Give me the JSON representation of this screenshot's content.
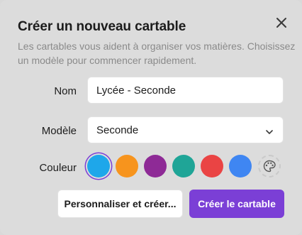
{
  "dialog": {
    "title": "Créer un nouveau cartable",
    "description": "Les cartables vous aident à organiser vos matières. Choisissez un modèle pour commencer rapidement."
  },
  "form": {
    "name_label": "Nom",
    "name_value": "Lycée - Seconde",
    "model_label": "Modèle",
    "model_value": "Seconde",
    "color_label": "Couleur",
    "colors": [
      {
        "name": "sky-blue",
        "hex": "#1ea7ea",
        "selected": true
      },
      {
        "name": "orange",
        "hex": "#f7941d",
        "selected": false
      },
      {
        "name": "purple",
        "hex": "#8e2a96",
        "selected": false
      },
      {
        "name": "teal",
        "hex": "#1fa597",
        "selected": false
      },
      {
        "name": "red",
        "hex": "#ea4444",
        "selected": false
      },
      {
        "name": "blue",
        "hex": "#3f86f2",
        "selected": false
      }
    ]
  },
  "actions": {
    "customize_label": "Personnaliser et créer...",
    "create_label": "Créer le cartable"
  },
  "icons": {
    "close": "close-icon",
    "chevron": "chevron-down-icon",
    "palette": "palette-icon"
  }
}
